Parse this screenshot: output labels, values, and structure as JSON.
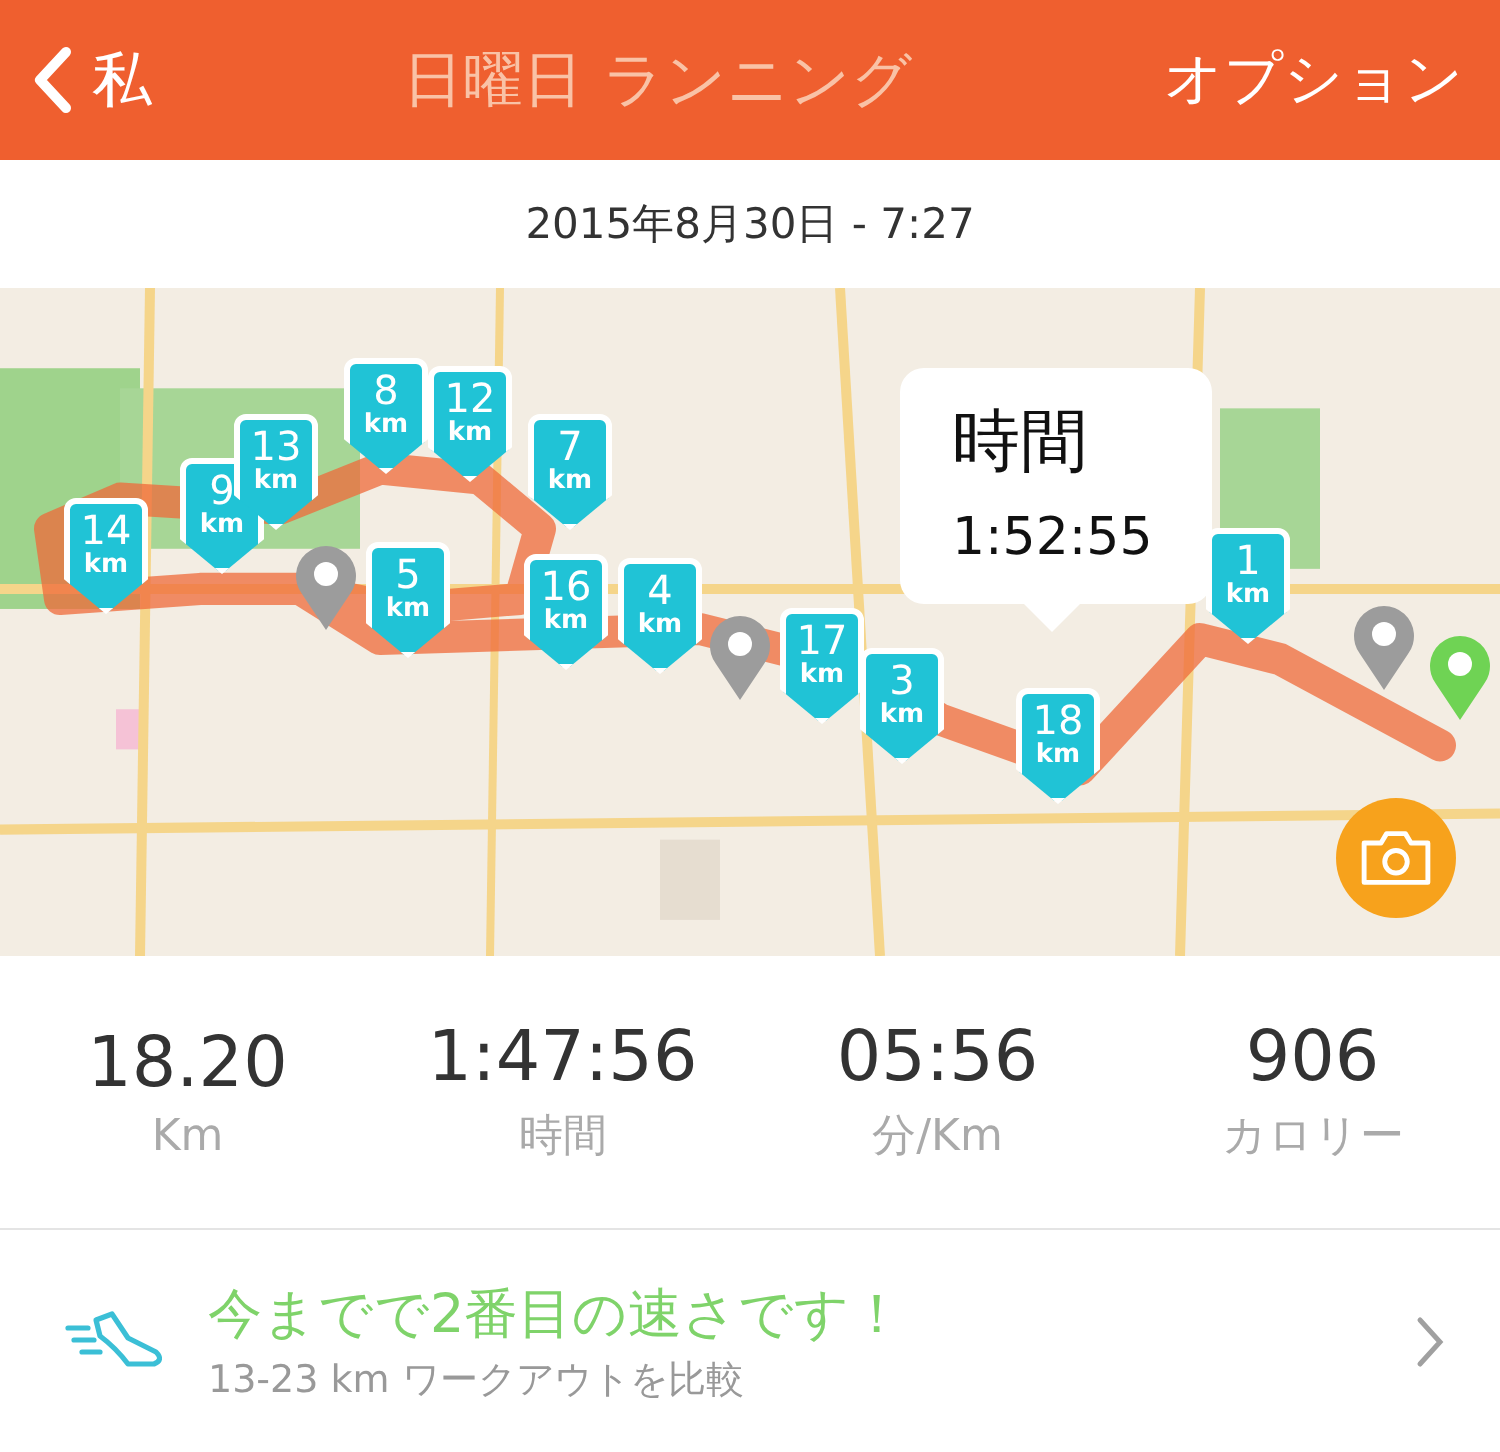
{
  "header": {
    "back_label": "私",
    "title": "日曜日 ランニング",
    "action": "オプション"
  },
  "date": "2015年8月30日 - 7:27",
  "map": {
    "markers": [
      {
        "label": "14",
        "unit": "km"
      },
      {
        "label": "9",
        "unit": "km"
      },
      {
        "label": "13",
        "unit": "km"
      },
      {
        "label": "8",
        "unit": "km"
      },
      {
        "label": "12",
        "unit": "km"
      },
      {
        "label": "7",
        "unit": "km"
      },
      {
        "label": "5",
        "unit": "km"
      },
      {
        "label": "16",
        "unit": "km"
      },
      {
        "label": "4",
        "unit": "km"
      },
      {
        "label": "17",
        "unit": "km"
      },
      {
        "label": "3",
        "unit": "km"
      },
      {
        "label": "18",
        "unit": "km"
      },
      {
        "label": "1",
        "unit": "km"
      }
    ],
    "callout": {
      "label": "時間",
      "value": "1:52:55"
    }
  },
  "stats": [
    {
      "value": "18.20",
      "unit": "Km"
    },
    {
      "value": "1:47:56",
      "unit": "時間"
    },
    {
      "value": "05:56",
      "unit": "分/Km"
    },
    {
      "value": "906",
      "unit": "カロリー"
    }
  ],
  "comparison": {
    "title": "今までで2番目の速さです！",
    "subtitle": "13-23 km ワークアウトを比較"
  }
}
